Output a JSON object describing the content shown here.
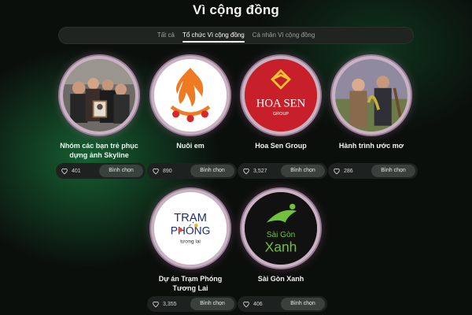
{
  "page": {
    "title": "Vì cộng đồng"
  },
  "tabs": [
    {
      "label": "Tất cả",
      "active": false
    },
    {
      "label": "Tổ chức Vì cộng đồng",
      "active": true
    },
    {
      "label": "Cá nhân Vì cộng đồng",
      "active": false
    }
  ],
  "vote_label": "Bình chọn",
  "cards": [
    {
      "name": "Nhóm các bạn trẻ phục dựng ảnh Skyline",
      "likes": "401",
      "image": "group-photo"
    },
    {
      "name": "Nuôi em",
      "likes": "890",
      "image": "nuoi-em-logo"
    },
    {
      "name": "Hoa Sen Group",
      "likes": "3,527",
      "image": "hoa-sen-logo"
    },
    {
      "name": "Hành trình ước mơ",
      "likes": "286",
      "image": "people-photo"
    },
    {
      "name": "Dự án Trạm Phóng Tương Lai",
      "likes": "3,355",
      "image": "tram-phong-logo"
    },
    {
      "name": "Sài Gòn Xanh",
      "likes": "406",
      "image": "sai-gon-xanh-logo"
    }
  ],
  "logos": {
    "hoa_sen_text": "HOA SEN",
    "hoa_sen_sub": "GROUP",
    "tram_line1": "TRẠM",
    "tram_line2": "PHÓNG",
    "tram_line3": "tương lai",
    "sgx_line1": "Sài Gòn",
    "sgx_line2": "Xanh"
  },
  "colors": {
    "accent": "#ffffff",
    "background": "#0b0f0c",
    "vote_button": "#3a403c"
  }
}
